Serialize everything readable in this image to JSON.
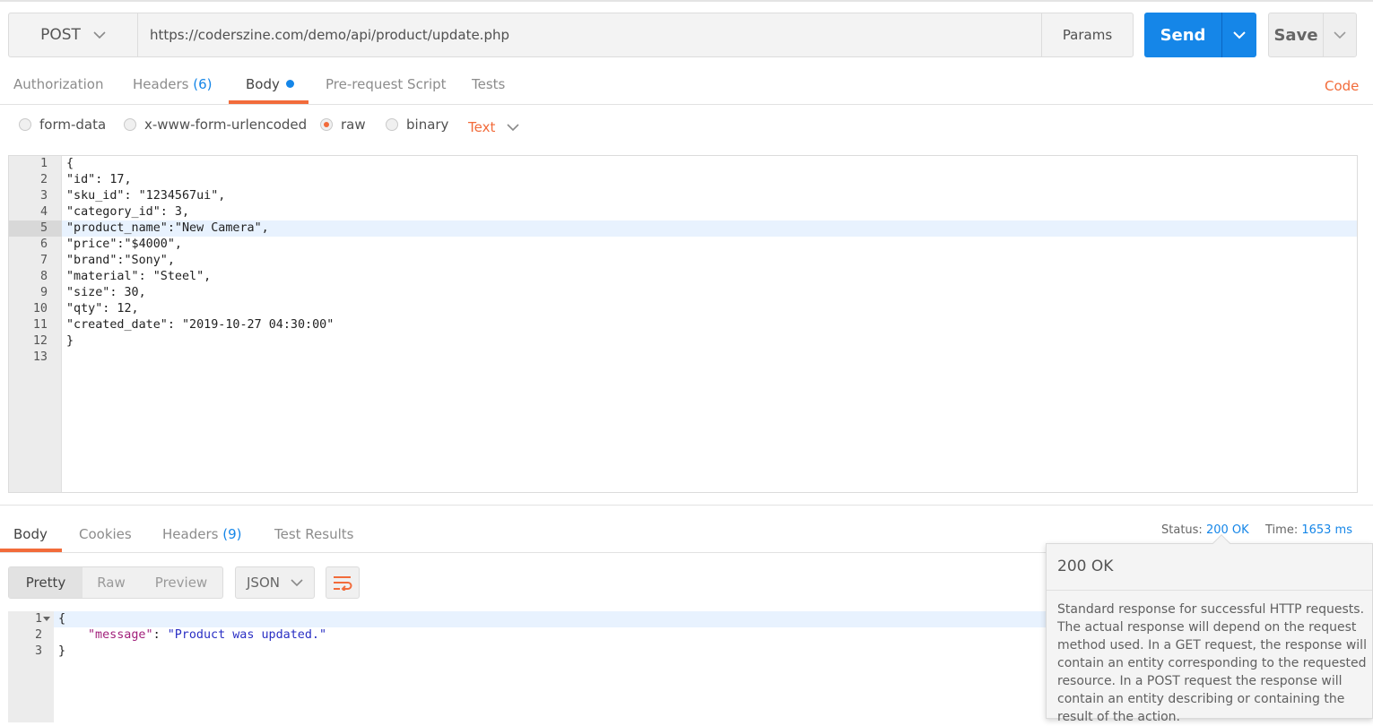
{
  "request": {
    "method": "POST",
    "url": "https://coderszine.com/demo/api/product/update.php",
    "params_label": "Params",
    "send_label": "Send",
    "save_label": "Save"
  },
  "request_tabs": {
    "authorization": "Authorization",
    "headers": "Headers",
    "headers_count": "(6)",
    "body": "Body",
    "pre_request": "Pre-request Script",
    "tests": "Tests",
    "code": "Code"
  },
  "body_types": {
    "form_data": "form-data",
    "urlencoded": "x-www-form-urlencoded",
    "raw": "raw",
    "binary": "binary",
    "selected": "raw",
    "content_type": "Text"
  },
  "request_body": {
    "active_line": 5,
    "lines": [
      "{",
      "\"id\": 17,",
      "\"sku_id\": \"1234567ui\",",
      "\"category_id\": 3,",
      "\"product_name\":\"New Camera\",",
      "\"price\":\"$4000\",",
      "\"brand\":\"Sony\",",
      "\"material\": \"Steel\",",
      "\"size\": 30,",
      "\"qty\": 12,",
      "\"created_date\": \"2019-10-27 04:30:00\"",
      "}",
      ""
    ]
  },
  "response_tabs": {
    "body": "Body",
    "cookies": "Cookies",
    "headers": "Headers",
    "headers_count": "(9)",
    "test_results": "Test Results"
  },
  "response_meta": {
    "status_label": "Status:",
    "status_value": "200 OK",
    "time_label": "Time:",
    "time_value": "1653 ms"
  },
  "response_view": {
    "pretty": "Pretty",
    "raw": "Raw",
    "preview": "Preview",
    "format": "JSON"
  },
  "response_body": {
    "line1": "{",
    "key": "\"message\"",
    "colon": ": ",
    "value": "\"Product was updated.\"",
    "line3": "}"
  },
  "tooltip": {
    "title": "200 OK",
    "description": "Standard response for successful HTTP requests. The actual response will depend on the request method used. In a GET request, the response will contain an entity corresponding to the requested resource. In a POST request the response will contain an entity describing or containing the result of the action."
  },
  "colors": {
    "accent_orange": "#f26b3a",
    "accent_blue": "#1586e8"
  }
}
